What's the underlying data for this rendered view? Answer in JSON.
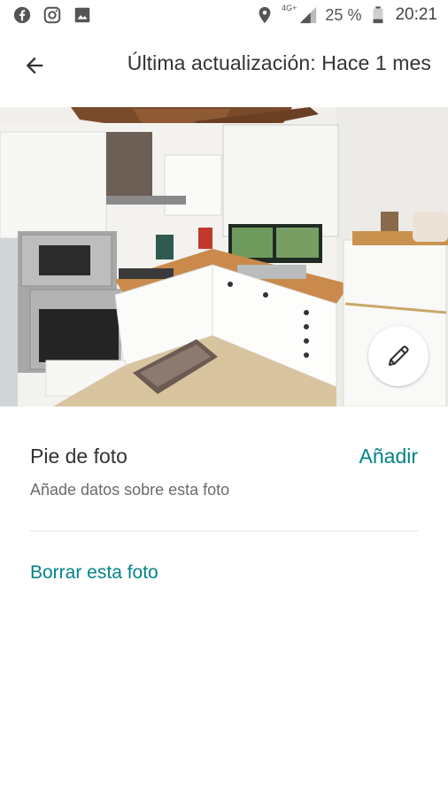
{
  "status_bar": {
    "left_icons": [
      "facebook-icon",
      "instagram-icon",
      "gallery-icon"
    ],
    "network": "4G+",
    "battery": "25 %",
    "time": "20:21"
  },
  "app_bar": {
    "title": "Última actualización: Hace 1 mes"
  },
  "caption": {
    "title": "Pie de foto",
    "add_label": "Añadir",
    "hint": "Añade datos sobre esta foto"
  },
  "delete_label": "Borrar esta foto",
  "colors": {
    "accent": "#008489",
    "text": "#333333",
    "secondary_text": "#6b6b6b"
  }
}
